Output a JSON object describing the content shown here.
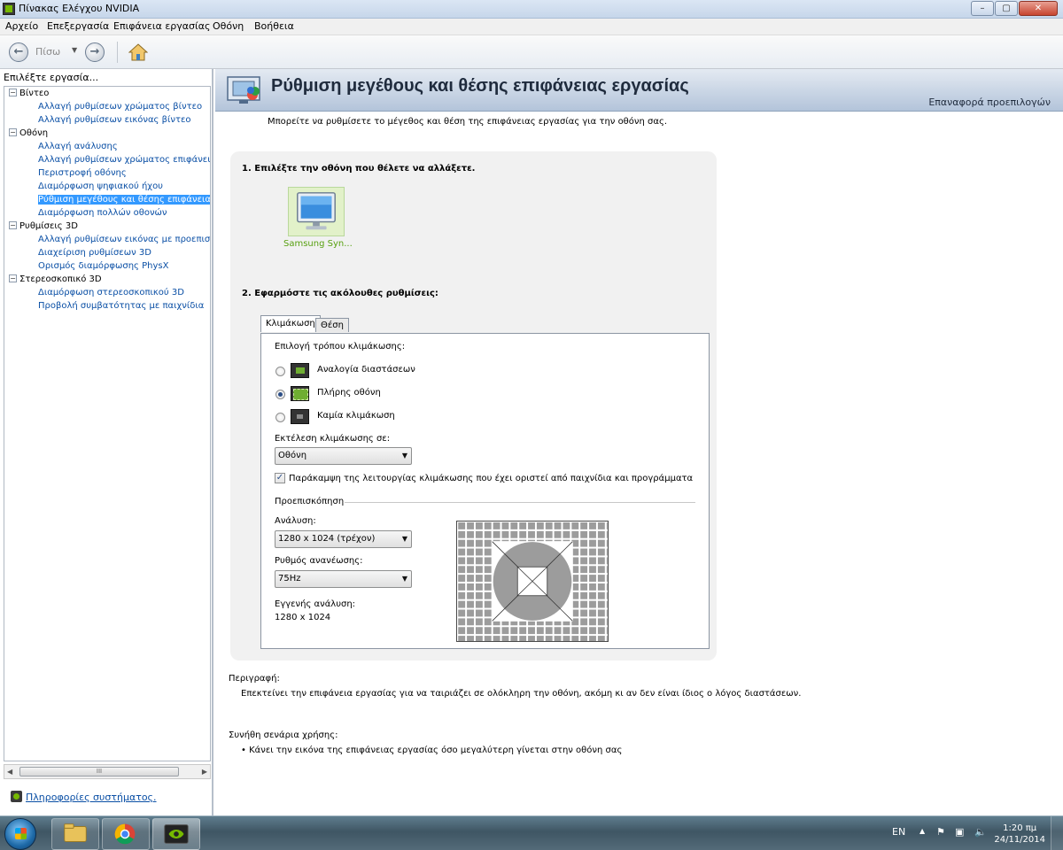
{
  "window": {
    "title": "Πίνακας Ελέγχου NVIDIA",
    "buttons": {
      "minimize": "–",
      "maximize": "▢",
      "close": "✕"
    }
  },
  "menu": [
    "Αρχείο",
    "Επεξεργασία",
    "Επιφάνεια εργασίας",
    "Οθόνη",
    "Βοήθεια"
  ],
  "toolbar": {
    "back_label": "Πίσω",
    "icons": [
      "back-arrow-icon",
      "forward-arrow-icon",
      "home-icon"
    ]
  },
  "sidebar": {
    "heading": "Επιλέξτε εργασία...",
    "tree": [
      {
        "label": "Βίντεο",
        "type": "category"
      },
      {
        "label": "Αλλαγή ρυθμίσεων χρώματος βίντεο",
        "type": "link"
      },
      {
        "label": "Αλλαγή ρυθμίσεων εικόνας βίντεο",
        "type": "link"
      },
      {
        "label": "Οθόνη",
        "type": "category"
      },
      {
        "label": "Αλλαγή ανάλυσης",
        "type": "link"
      },
      {
        "label": "Αλλαγή ρυθμίσεων χρώματος επιφάνειας ερ",
        "type": "link"
      },
      {
        "label": "Περιστροφή οθόνης",
        "type": "link"
      },
      {
        "label": "Διαμόρφωση ψηφιακού ήχου",
        "type": "link"
      },
      {
        "label": "Ρύθμιση μεγέθους και θέσης επιφάνειας εργ",
        "type": "link",
        "selected": true
      },
      {
        "label": "Διαμόρφωση πολλών οθονών",
        "type": "link"
      },
      {
        "label": "Ρυθμίσεις 3D",
        "type": "category"
      },
      {
        "label": "Αλλαγή ρυθμίσεων εικόνας με προεπισκόπη",
        "type": "link"
      },
      {
        "label": "Διαχείριση ρυθμίσεων 3D",
        "type": "link"
      },
      {
        "label": "Ορισμός διαμόρφωσης PhysX",
        "type": "link"
      },
      {
        "label": "Στερεοσκοπικό 3D",
        "type": "category"
      },
      {
        "label": "Διαμόρφωση στερεοσκοπικού 3D",
        "type": "link"
      },
      {
        "label": "Προβολή συμβατότητας με παιχνίδια",
        "type": "link"
      }
    ],
    "scroll_grip": "III",
    "system_info_link": "Πληροφορίες συστήματος."
  },
  "page": {
    "title": "Ρύθμιση μεγέθους και θέσης επιφάνειας εργασίας",
    "restore_defaults": "Επαναφορά προεπιλογών",
    "intro": "Μπορείτε να ρυθμίσετε το μέγεθος και θέση της επιφάνειας εργασίας για την οθόνη σας.",
    "step1": "1. Επιλέξτε την οθόνη που θέλετε να αλλάξετε.",
    "monitor_label": "Samsung Syn...",
    "step2": "2. Εφαρμόστε τις ακόλουθες ρυθμίσεις:",
    "tabs": [
      "Κλιμάκωση",
      "Θέση"
    ],
    "scaling": {
      "mode_label": "Επιλογή τρόπου κλιμάκωσης:",
      "options": [
        "Αναλογία διαστάσεων",
        "Πλήρης οθόνη",
        "Καμία κλιμάκωση"
      ],
      "selected_option": "Πλήρης οθόνη",
      "perform_on_label": "Εκτέλεση κλιμάκωσης σε:",
      "perform_on_value": "Οθόνη",
      "override_checkbox": "Παράκαμψη της λειτουργίας κλιμάκωσης που έχει οριστεί από παιχνίδια και προγράμματα",
      "override_checked": true,
      "preview_label": "Προεπισκόπηση",
      "resolution_label": "Ανάλυση:",
      "resolution_value": "1280 x 1024 (τρέχον)",
      "refresh_label": "Ρυθμός ανανέωσης:",
      "refresh_value": "75Hz",
      "native_label": "Εγγενής ανάλυση:",
      "native_value": "1280 x 1024"
    },
    "description_head": "Περιγραφή:",
    "description_text": "Επεκτείνει την επιφάνεια εργασίας για να ταιριάζει σε ολόκληρη την οθόνη, ακόμη κι αν δεν είναι ίδιος ο λόγος διαστάσεων.",
    "usage_head": "Συνήθη σενάρια χρήσης:",
    "usage_text": "• Κάνει την εικόνα της επιφάνειας εργασίας όσο μεγαλύτερη γίνεται στην οθόνη σας"
  },
  "taskbar": {
    "apps": [
      "windows-explorer-icon",
      "chrome-icon",
      "nvidia-icon"
    ],
    "lang": "EN",
    "time": "1:20 πμ",
    "date": "24/11/2014"
  },
  "colors": {
    "link": "#0a4fa5",
    "selection": "#3399ff",
    "nvidia_green": "#76b900",
    "banner": "#b3c4da"
  }
}
